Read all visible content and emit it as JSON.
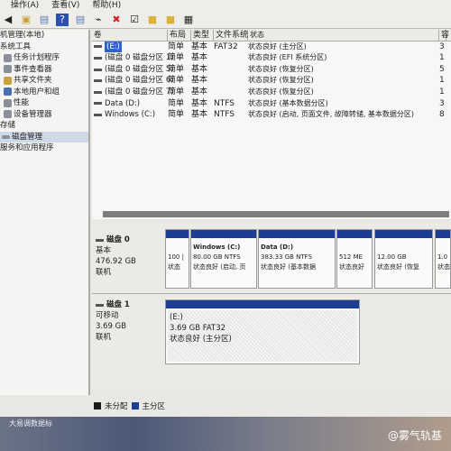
{
  "menu": [
    "操作(A)",
    "查看(V)",
    "帮助(H)"
  ],
  "tree": [
    {
      "label": "机管理(本地)",
      "icon": "computer-icon"
    },
    {
      "label": "系统工具",
      "icon": "tools-icon"
    },
    {
      "label": "任务计划程序",
      "icon": "clock-icon"
    },
    {
      "label": "事件查看器",
      "icon": "event-icon"
    },
    {
      "label": "共享文件夹",
      "icon": "folder-icon"
    },
    {
      "label": "本地用户和组",
      "icon": "users-icon"
    },
    {
      "label": "性能",
      "icon": "performance-icon"
    },
    {
      "label": "设备管理器",
      "icon": "device-icon"
    },
    {
      "label": "存储",
      "icon": ""
    },
    {
      "label": "磁盘管理",
      "icon": "disk-icon",
      "selected": true
    },
    {
      "label": "服务和应用程序",
      "icon": ""
    }
  ],
  "columns": [
    "卷",
    "布局",
    "类型",
    "文件系统",
    "状态",
    "容"
  ],
  "volumes": [
    {
      "name": "(E:)",
      "layout": "简单",
      "type": "基本",
      "fs": "FAT32",
      "status": "状态良好 (主分区)",
      "cap": "3"
    },
    {
      "name": "(磁盘 0 磁盘分区 1)",
      "layout": "简单",
      "type": "基本",
      "fs": "",
      "status": "状态良好 (EFI 系统分区)",
      "cap": "1"
    },
    {
      "name": "(磁盘 0 磁盘分区 5)",
      "layout": "简单",
      "type": "基本",
      "fs": "",
      "status": "状态良好 (恢复分区)",
      "cap": "5"
    },
    {
      "name": "(磁盘 0 磁盘分区 6)",
      "layout": "简单",
      "type": "基本",
      "fs": "",
      "status": "状态良好 (恢复分区)",
      "cap": "1"
    },
    {
      "name": "(磁盘 0 磁盘分区 7)",
      "layout": "简单",
      "type": "基本",
      "fs": "",
      "status": "状态良好 (恢复分区)",
      "cap": "1"
    },
    {
      "name": "Data (D:)",
      "layout": "简单",
      "type": "基本",
      "fs": "NTFS",
      "status": "状态良好 (基本数据分区)",
      "cap": "3"
    },
    {
      "name": "Windows (C:)",
      "layout": "简单",
      "type": "基本",
      "fs": "NTFS",
      "status": "状态良好 (启动, 页面文件, 故障转储, 基本数据分区)",
      "cap": "8"
    }
  ],
  "disk0": {
    "name": "磁盘 0",
    "type": "基本",
    "size": "476.92 GB",
    "state": "联机",
    "parts": [
      {
        "title": "",
        "l1": "100 |",
        "l2": "状态"
      },
      {
        "title": "Windows (C:)",
        "l1": "80.00 GB NTFS",
        "l2": "状态良好 (启动, 页"
      },
      {
        "title": "Data (D:)",
        "l1": "383.33 GB NTFS",
        "l2": "状态良好 (基本数据"
      },
      {
        "title": "",
        "l1": "512 ME",
        "l2": "状态良好"
      },
      {
        "title": "",
        "l1": "12.00 GB",
        "l2": "状态良好 (恢复"
      },
      {
        "title": "",
        "l1": "1.0",
        "l2": "状态"
      }
    ]
  },
  "disk1": {
    "name": "磁盘 1",
    "type": "可移动",
    "size": "3.69 GB",
    "state": "联机",
    "part": {
      "title": "(E:)",
      "l1": "3.69 GB FAT32",
      "l2": "状态良好 (主分区)"
    }
  },
  "legend": [
    {
      "label": "未分配",
      "color": "#1a1a1a"
    },
    {
      "label": "主分区",
      "color": "#1c3d94"
    }
  ],
  "desktop": {
    "icon_label": "大易调数据标",
    "watermark": "@雾气轨基"
  }
}
